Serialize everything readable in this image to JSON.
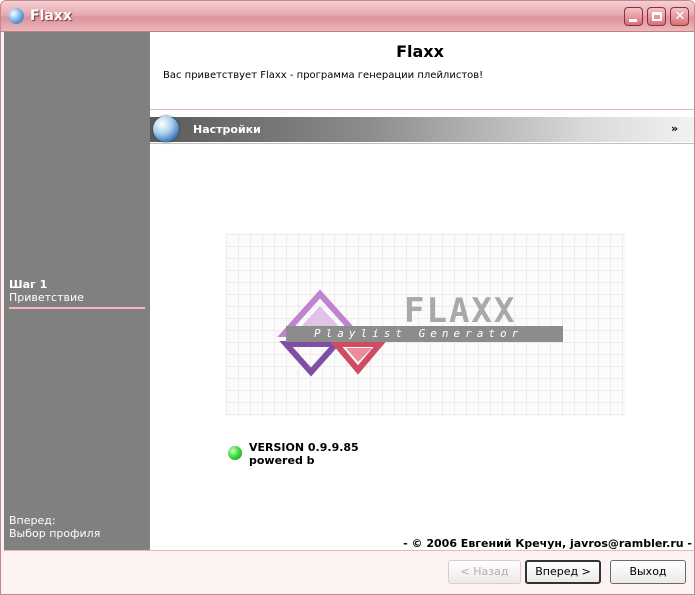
{
  "window": {
    "title": "Flaxx"
  },
  "sidebar": {
    "step_title": "Шаг 1",
    "step_name": "Приветствие",
    "next_title": "Вперед:",
    "next_name": "Выбор профиля"
  },
  "main": {
    "title": "Flaxx",
    "welcome": "Вас приветствует Flaxx - программа генерации плейлистов!",
    "section_label": "Настройки",
    "logo_word": "FLAXX",
    "logo_subtitle": "Playlist Generator",
    "version": "VERSION 0.9.9.85",
    "powered": "powered b",
    "copyright": "- © 2006 Евгений Кречун, javros@rambler.ru -"
  },
  "buttons": {
    "back": "< Назад",
    "next": "Вперед >",
    "exit": "Выход"
  }
}
